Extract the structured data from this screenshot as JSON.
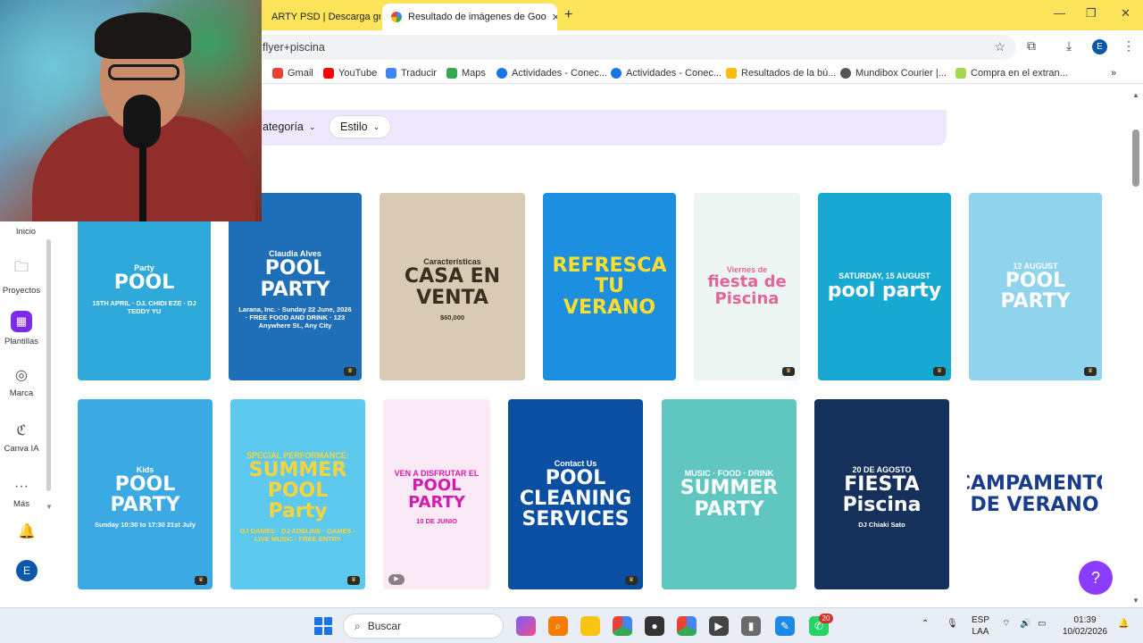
{
  "browser": {
    "tabs": [
      {
        "title": "ARTY PSD | Descarga gr"
      },
      {
        "title": "Resultado de imágenes de Goo"
      }
    ],
    "new_tab_symbol": "+",
    "address": "flyer+piscina",
    "profile_initial": "E",
    "bookmarks": [
      {
        "label": "Gmail",
        "color": "#ea4335"
      },
      {
        "label": "YouTube",
        "color": "#ff0000"
      },
      {
        "label": "Traducir",
        "color": "#4285f4"
      },
      {
        "label": "Maps",
        "color": "#34a853"
      },
      {
        "label": "Actividades - Conec...",
        "color": "#1a73e8"
      },
      {
        "label": "Actividades - Conec...",
        "color": "#1a73e8"
      },
      {
        "label": "Resultados de la bú...",
        "color": "#fbbc05"
      },
      {
        "label": "Mundibox Courier |...",
        "color": "#555555"
      },
      {
        "label": "Compra en el extran...",
        "color": "#a3d94c"
      }
    ]
  },
  "filters": {
    "category": "ategoría",
    "style": "Estilo"
  },
  "sidebar": {
    "items": [
      {
        "label": "Inicio",
        "icon": "home-icon"
      },
      {
        "label": "Proyectos",
        "icon": "folder-icon"
      },
      {
        "label": "Plantillas",
        "icon": "templates-icon"
      },
      {
        "label": "Marca",
        "icon": "brand-icon"
      },
      {
        "label": "Canva IA",
        "icon": "canva-ai-icon"
      },
      {
        "label": "Más",
        "icon": "more-icon"
      }
    ],
    "avatar_initial": "E"
  },
  "templates": {
    "row1": [
      {
        "title": "POOL",
        "subtitle": "Party",
        "extra": "15TH APRIL · DJ. CHIDI EZE · DJ TEDDY YU",
        "bg": "#2fa9d9",
        "fg": "#ffffff"
      },
      {
        "title": "POOL PARTY",
        "subtitle": "Claudia Alves",
        "extra": "Larana, Inc. · Sunday 22 June, 2026 · FREE FOOD AND DRINK · 123 Anywhere St., Any City",
        "bg": "#1f6fb8",
        "fg": "#ffffff"
      },
      {
        "title": "CASA EN VENTA",
        "subtitle": "Características",
        "extra": "$60,000",
        "bg": "#d9cbb3",
        "fg": "#3b2f22"
      },
      {
        "title": "REFRESCA TU VERANO",
        "subtitle": "",
        "extra": "",
        "bg": "#1d8fe0",
        "fg": "#ffdd2b"
      },
      {
        "title": "fiesta de Piscina",
        "subtitle": "Viernes de",
        "extra": "",
        "bg": "#eef6f4",
        "fg": "#e2669a"
      },
      {
        "title": "pool party",
        "subtitle": "SATURDAY, 15 AUGUST",
        "extra": "",
        "bg": "#18a9d3",
        "fg": "#ffffff"
      },
      {
        "title": "POOL PARTY",
        "subtitle": "12 AUGUST",
        "extra": "",
        "bg": "#8fd3ec",
        "fg": "#ffffff"
      }
    ],
    "row2": [
      {
        "title": "POOL PARTY",
        "subtitle": "Kids",
        "extra": "Sunday 10:30 to 17:30 21st July",
        "bg": "#3aa9e4",
        "fg": "#ffffff"
      },
      {
        "title": "SUMMER POOL Party",
        "subtitle": "SPECIAL PERFORMANCE:",
        "extra": "DJ DANIEL · DJ ADELINE · GAMES - LIVE MUSIC - FREE ENTRY",
        "bg": "#5ec9ef",
        "fg": "#f7d33c"
      },
      {
        "title": "POOL PARTY",
        "subtitle": "VEN A DISFRUTAR EL",
        "extra": "10 DE JUNIO",
        "bg": "#fbe9f5",
        "fg": "#d31bb0"
      },
      {
        "title": "POOL CLEANING SERVICES",
        "subtitle": "Contact Us",
        "extra": "",
        "bg": "#0b4fa3",
        "fg": "#ffffff"
      },
      {
        "title": "SUMMER PARTY",
        "subtitle": "MUSIC · FOOD · DRINK",
        "extra": "",
        "bg": "#5fc7c0",
        "fg": "#ffffff"
      },
      {
        "title": "FIESTA Piscina",
        "subtitle": "20 DE AGOSTO",
        "extra": "DJ Chiaki Sato",
        "bg": "#16305c",
        "fg": "#ffffff"
      },
      {
        "title": "CAMPAMENTO DE VERANO",
        "subtitle": "",
        "extra": "",
        "bg": "#ffffff",
        "fg": "#1a3c8e"
      }
    ]
  },
  "help": {
    "label": "?"
  },
  "taskbar": {
    "search_label": "Buscar",
    "whatsapp_badge": "20",
    "lang": "ESP",
    "lang2": "LAA",
    "time": "01:39",
    "date": "10/02/2026"
  }
}
